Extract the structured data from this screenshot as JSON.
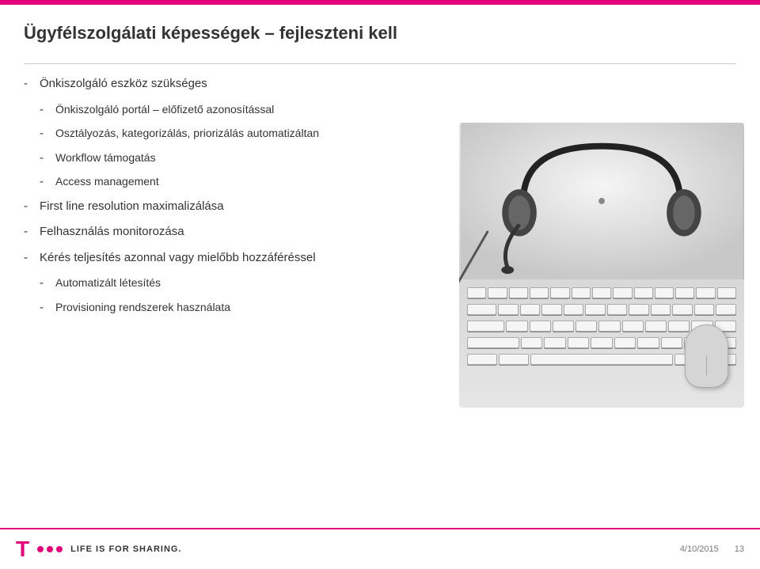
{
  "slide": {
    "title": "Ügyfélszolgálati képességek – fejleszteni kell",
    "bullets": [
      {
        "id": "bullet-1",
        "text": "Önkiszolgáló eszköz szükséges",
        "subitems": []
      },
      {
        "id": "bullet-2",
        "text": "Önkiszolgáló portál – előfizető azonosítással",
        "subitems": []
      },
      {
        "id": "bullet-3",
        "text": "Osztályozás, kategorizálás, priorizálás automatizáltan",
        "subitems": []
      },
      {
        "id": "bullet-4",
        "text": "Workflow támogatás",
        "subitems": []
      },
      {
        "id": "bullet-5",
        "text": "Access management",
        "subitems": []
      }
    ],
    "main_bullets": [
      {
        "id": "main-bullet-1",
        "text": "First line resolution  maximalizálása"
      },
      {
        "id": "main-bullet-2",
        "text": "Felhasználás monitorozása"
      },
      {
        "id": "main-bullet-3",
        "text": "Kérés teljesítés azonnal vagy mielőbb hozzáféréssel",
        "subitems": [
          {
            "id": "sub-1",
            "text": "Automatizált létesítés"
          },
          {
            "id": "sub-2",
            "text": "Provisioning rendszerek használata"
          }
        ]
      }
    ]
  },
  "footer": {
    "tagline": "LIFE IS FOR SHARING.",
    "date": "4/10/2015",
    "page": "13"
  },
  "colors": {
    "magenta": "#e2007a",
    "dark_text": "#333333",
    "light_gray": "#cccccc"
  }
}
